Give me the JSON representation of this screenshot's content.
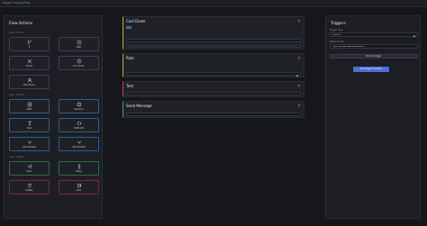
{
  "breadcrumb": "Project / Saved Flow",
  "left_panel": {
    "title": "Flow Actions",
    "sections": [
      {
        "label": "Logic / Timers"
      },
      {
        "label": "Logic / Actions"
      },
      {
        "label": "Logic / Output"
      }
    ],
    "buttons": [
      {
        "label": "If",
        "icon": "branch-icon"
      },
      {
        "label": "Wait",
        "icon": "clock-icon"
      },
      {
        "label": "End If",
        "icon": "close-icon"
      },
      {
        "label": "Cool Down",
        "icon": "clock-icon"
      },
      {
        "label": "Role Check",
        "icon": "user-icon"
      },
      {
        "label": "Math",
        "icon": "calculator-icon"
      },
      {
        "label": "Random",
        "icon": "dice-icon"
      },
      {
        "label": "Text",
        "icon": "text-icon"
      },
      {
        "label": "JSON API",
        "icon": "code-icon"
      },
      {
        "label": "Get Variable",
        "icon": "variable-icon"
      },
      {
        "label": "Set Variable",
        "icon": "variable-icon"
      },
      {
        "label": "Send",
        "icon": "send-icon"
      },
      {
        "label": "Delay",
        "icon": "hourglass-icon"
      },
      {
        "label": "Delete",
        "icon": "trash-icon"
      },
      {
        "label": "Exit",
        "icon": "exit-icon"
      }
    ]
  },
  "flow": {
    "nodes": [
      {
        "title": "Cool Down"
      },
      {
        "title": "Role"
      },
      {
        "title": "Text"
      },
      {
        "title": "Send Message"
      }
    ]
  },
  "triggers": {
    "title": "Triggers",
    "trigger_type_label": "Trigger Type",
    "trigger_type_value": "Webhook",
    "webhook_url_label": "Webhook URL",
    "webhook_url_value": "https://example.app/api/webhook/...",
    "remove_label": "Remove Trigger",
    "add_label": "Add Trigger Condition"
  },
  "colors": {
    "accent": "#4c6ed6",
    "node_yellow": "#cfa24a",
    "node_red": "#b84a57",
    "node_green": "#3fa56a"
  }
}
